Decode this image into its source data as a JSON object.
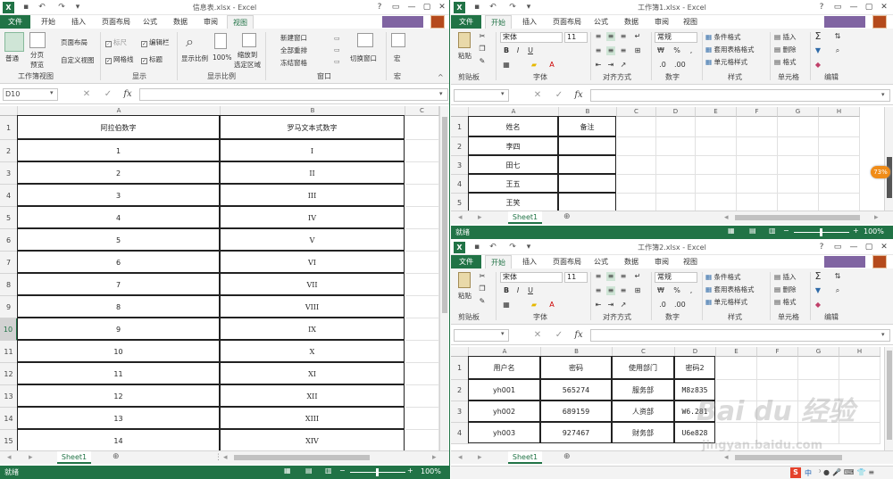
{
  "left": {
    "title": "信息表.xlsx - Excel",
    "tabs": [
      "文件",
      "开始",
      "插入",
      "页面布局",
      "公式",
      "数据",
      "审阅",
      "视图"
    ],
    "active_tab": "视图",
    "ribbon": {
      "normal": "普通",
      "page_break": "分页\n预览",
      "page_layout": "页面布局",
      "custom_views": "自定义视图",
      "ruler": "标尺",
      "gridlines": "网格线",
      "formula_bar": "编辑栏",
      "headings": "标题",
      "zoom": "显示比例",
      "zoom100": "100%",
      "zoom_sel": "缩放到\n选定区域",
      "new_window": "新建窗口",
      "arrange_all": "全部重排",
      "freeze": "冻结窗格",
      "switch_window": "切换窗口",
      "macros": "宏",
      "groups": [
        "工作簿视图",
        "显示",
        "显示比例",
        "窗口",
        "宏"
      ]
    },
    "namebox": "D10",
    "columns": [
      "A",
      "B",
      "C"
    ],
    "headers": [
      "阿拉伯数字",
      "罗马文本式数字"
    ],
    "rows": [
      [
        "1",
        "I"
      ],
      [
        "2",
        "II"
      ],
      [
        "3",
        "III"
      ],
      [
        "4",
        "IV"
      ],
      [
        "5",
        "V"
      ],
      [
        "6",
        "VI"
      ],
      [
        "7",
        "VII"
      ],
      [
        "8",
        "VIII"
      ],
      [
        "9",
        "IX"
      ],
      [
        "10",
        "X"
      ],
      [
        "11",
        "XI"
      ],
      [
        "12",
        "XII"
      ],
      [
        "13",
        "XIII"
      ],
      [
        "14",
        "XIV"
      ]
    ],
    "row_numbers": [
      "1",
      "2",
      "3",
      "4",
      "5",
      "6",
      "7",
      "8",
      "9",
      "10",
      "11",
      "12",
      "13",
      "14",
      "15"
    ],
    "sheet": "Sheet1",
    "status": "就绪",
    "zoom": "100%"
  },
  "right_top": {
    "title": "工作簿1.xlsx - Excel",
    "tabs": [
      "文件",
      "开始",
      "插入",
      "页面布局",
      "公式",
      "数据",
      "审阅",
      "视图"
    ],
    "active_tab": "开始",
    "ribbon": {
      "paste": "粘贴",
      "font": "宋体",
      "size": "11",
      "number_format": "常规",
      "cond_format": "条件格式",
      "table_format": "套用表格格式",
      "cell_styles": "单元格样式",
      "insert": "插入",
      "delete": "删除",
      "format": "格式",
      "groups": [
        "剪贴板",
        "字体",
        "对齐方式",
        "数字",
        "样式",
        "单元格",
        "编辑"
      ]
    },
    "columns": [
      "A",
      "B",
      "C",
      "D",
      "E",
      "F",
      "G",
      "H"
    ],
    "headers": [
      "姓名",
      "备注"
    ],
    "rows": [
      [
        "李四",
        ""
      ],
      [
        "田七",
        ""
      ],
      [
        "王五",
        ""
      ],
      [
        "王笑",
        ""
      ]
    ],
    "row_numbers": [
      "1",
      "2",
      "3",
      "4",
      "5"
    ],
    "sheet": "Sheet1",
    "status": "就绪",
    "zoom": "100%",
    "badge": "73%"
  },
  "right_bottom": {
    "title": "工作簿2.xlsx - Excel",
    "tabs": [
      "文件",
      "开始",
      "插入",
      "页面布局",
      "公式",
      "数据",
      "审阅",
      "视图"
    ],
    "active_tab": "开始",
    "ribbon": {
      "paste": "粘贴",
      "font": "宋体",
      "size": "11",
      "number_format": "常规",
      "cond_format": "条件格式",
      "table_format": "套用表格格式",
      "cell_styles": "单元格样式",
      "insert": "插入",
      "delete": "删除",
      "format": "格式",
      "groups": [
        "剪贴板",
        "字体",
        "对齐方式",
        "数字",
        "样式",
        "单元格",
        "编辑"
      ]
    },
    "columns": [
      "A",
      "B",
      "C",
      "D",
      "E",
      "F",
      "G",
      "H"
    ],
    "headers": [
      "用户名",
      "密码",
      "使用部门",
      "密码2"
    ],
    "rows": [
      [
        "yh001",
        "565274",
        "服务部",
        "M8z835"
      ],
      [
        "yh002",
        "689159",
        "人资部",
        "W6.281"
      ],
      [
        "yh003",
        "927467",
        "财务部",
        "U6e828"
      ]
    ],
    "row_numbers": [
      "1",
      "2",
      "3",
      "4"
    ],
    "sheet": "Sheet1"
  },
  "watermark": {
    "logo": "Bai du 经验",
    "url": "jingyan.baidu.com"
  },
  "tray": [
    "S",
    "中"
  ]
}
